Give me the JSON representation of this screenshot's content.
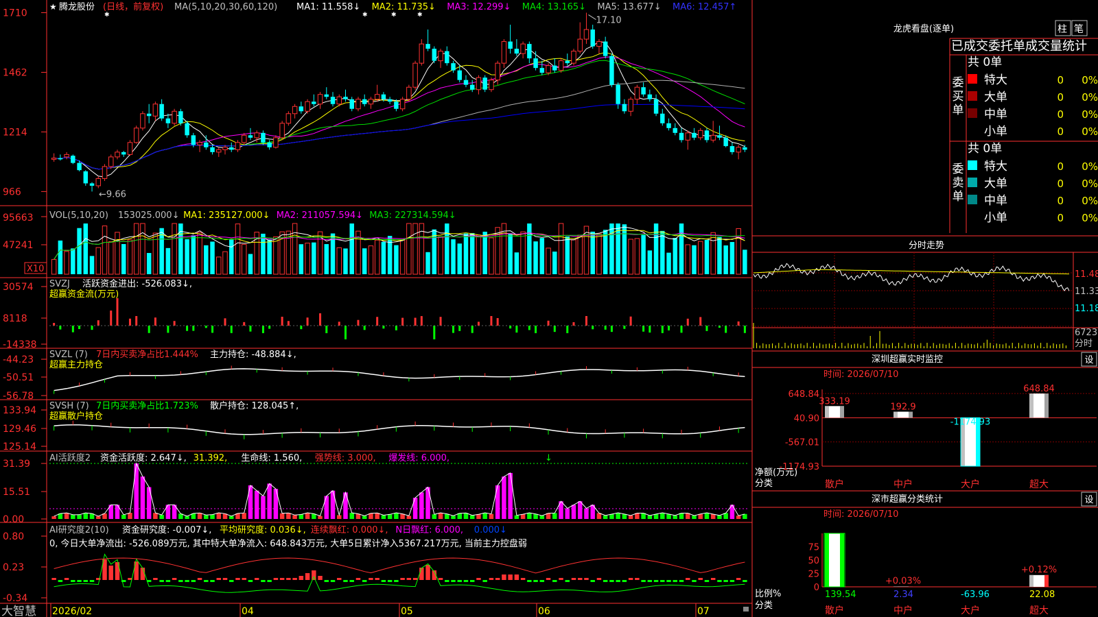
{
  "stock": {
    "name": "腾龙股份",
    "mode": "(日线，前复权)"
  },
  "colors": {
    "up": "#ff3232",
    "down": "#00ffff",
    "ma1": "#ffffff",
    "ma2": "#ffff00",
    "ma3": "#ff00ff",
    "ma4": "#00e000",
    "ma5": "#b0b0b0",
    "ma6": "#0000ff",
    "axis": "#ff3030",
    "grid": "#800000",
    "magenta": "#ff00ff",
    "green": "#00ff00",
    "label": "#ff4040",
    "sideText": "#c0c0c0"
  },
  "kline": {
    "ma_header": "MA(5,10,20,30,60,120)",
    "ma_values": [
      {
        "label": "MA1: 11.558↓",
        "color": "#ffffff"
      },
      {
        "label": "MA2: 11.735↓",
        "color": "#ffff00"
      },
      {
        "label": "MA3: 12.299↓",
        "color": "#ff00ff"
      },
      {
        "label": "MA4: 13.165↓",
        "color": "#00e000"
      },
      {
        "label": "MA5: 13.677↓",
        "color": "#c0c0c0"
      },
      {
        "label": "MA6: 12.457↑",
        "color": "#3333ff"
      }
    ],
    "y_ticks": [
      "1710",
      "1462",
      "1214",
      "966"
    ],
    "high_label": "17.10",
    "low_label": "9.66",
    "candles": [
      {
        "o": 11.0,
        "h": 11.25,
        "l": 10.9,
        "c": 11.05
      },
      {
        "o": 11.05,
        "h": 11.2,
        "l": 10.95,
        "c": 11.0
      },
      {
        "o": 11.1,
        "h": 11.3,
        "l": 11.0,
        "c": 11.2
      },
      {
        "o": 11.15,
        "h": 11.2,
        "l": 10.8,
        "c": 10.85
      },
      {
        "o": 10.85,
        "h": 10.95,
        "l": 10.5,
        "c": 10.55
      },
      {
        "o": 10.5,
        "h": 10.55,
        "l": 9.9,
        "c": 10.0
      },
      {
        "o": 10.0,
        "h": 10.05,
        "l": 9.66,
        "c": 9.9
      },
      {
        "o": 9.9,
        "h": 10.3,
        "l": 9.8,
        "c": 10.2
      },
      {
        "o": 10.2,
        "h": 10.8,
        "l": 10.1,
        "c": 10.7
      },
      {
        "o": 10.7,
        "h": 11.2,
        "l": 10.6,
        "c": 11.1
      },
      {
        "o": 11.1,
        "h": 11.4,
        "l": 11.0,
        "c": 11.3
      },
      {
        "o": 11.3,
        "h": 11.35,
        "l": 11.1,
        "c": 11.2
      },
      {
        "o": 11.2,
        "h": 11.8,
        "l": 11.15,
        "c": 11.7
      },
      {
        "o": 11.7,
        "h": 12.4,
        "l": 11.65,
        "c": 12.3
      },
      {
        "o": 12.3,
        "h": 13.0,
        "l": 12.2,
        "c": 12.9
      },
      {
        "o": 12.9,
        "h": 13.3,
        "l": 12.5,
        "c": 12.8
      },
      {
        "o": 12.8,
        "h": 13.4,
        "l": 12.6,
        "c": 13.3
      },
      {
        "o": 13.3,
        "h": 13.5,
        "l": 12.6,
        "c": 12.7
      },
      {
        "o": 12.7,
        "h": 12.9,
        "l": 12.3,
        "c": 12.5
      },
      {
        "o": 12.5,
        "h": 13.1,
        "l": 12.4,
        "c": 13.0
      },
      {
        "o": 13.0,
        "h": 13.1,
        "l": 12.4,
        "c": 12.5
      },
      {
        "o": 12.5,
        "h": 12.6,
        "l": 11.9,
        "c": 12.0
      },
      {
        "o": 12.0,
        "h": 12.1,
        "l": 11.5,
        "c": 11.6
      },
      {
        "o": 11.6,
        "h": 11.8,
        "l": 11.3,
        "c": 11.7
      },
      {
        "o": 11.7,
        "h": 12.0,
        "l": 11.4,
        "c": 11.5
      },
      {
        "o": 11.5,
        "h": 11.6,
        "l": 11.2,
        "c": 11.3
      },
      {
        "o": 11.3,
        "h": 11.5,
        "l": 11.1,
        "c": 11.4
      },
      {
        "o": 11.4,
        "h": 11.6,
        "l": 11.2,
        "c": 11.5
      },
      {
        "o": 11.5,
        "h": 11.7,
        "l": 11.3,
        "c": 11.4
      },
      {
        "o": 11.4,
        "h": 11.8,
        "l": 11.3,
        "c": 11.7
      },
      {
        "o": 11.7,
        "h": 12.1,
        "l": 11.6,
        "c": 12.0
      },
      {
        "o": 12.0,
        "h": 12.3,
        "l": 11.8,
        "c": 11.9
      },
      {
        "o": 11.9,
        "h": 12.2,
        "l": 11.7,
        "c": 12.1
      },
      {
        "o": 12.1,
        "h": 12.2,
        "l": 11.6,
        "c": 11.7
      },
      {
        "o": 11.7,
        "h": 11.8,
        "l": 11.4,
        "c": 11.5
      },
      {
        "o": 11.5,
        "h": 12.0,
        "l": 11.45,
        "c": 11.9
      },
      {
        "o": 11.9,
        "h": 12.6,
        "l": 11.8,
        "c": 12.5
      },
      {
        "o": 12.5,
        "h": 13.0,
        "l": 12.4,
        "c": 12.9
      },
      {
        "o": 12.9,
        "h": 13.3,
        "l": 12.7,
        "c": 13.2
      },
      {
        "o": 13.2,
        "h": 13.4,
        "l": 12.9,
        "c": 13.0
      },
      {
        "o": 13.0,
        "h": 13.5,
        "l": 12.9,
        "c": 13.4
      },
      {
        "o": 13.4,
        "h": 13.7,
        "l": 13.2,
        "c": 13.3
      },
      {
        "o": 13.3,
        "h": 13.8,
        "l": 13.1,
        "c": 13.7
      },
      {
        "o": 13.7,
        "h": 14.0,
        "l": 13.5,
        "c": 13.6
      },
      {
        "o": 13.6,
        "h": 13.8,
        "l": 13.2,
        "c": 13.3
      },
      {
        "o": 13.3,
        "h": 13.7,
        "l": 13.2,
        "c": 13.6
      },
      {
        "o": 13.6,
        "h": 13.9,
        "l": 13.4,
        "c": 13.5
      },
      {
        "o": 13.5,
        "h": 13.6,
        "l": 13.0,
        "c": 13.1
      },
      {
        "o": 13.1,
        "h": 13.6,
        "l": 13.0,
        "c": 13.5
      },
      {
        "o": 13.5,
        "h": 13.7,
        "l": 13.2,
        "c": 13.3
      },
      {
        "o": 13.3,
        "h": 13.6,
        "l": 13.1,
        "c": 13.5
      },
      {
        "o": 13.5,
        "h": 14.1,
        "l": 13.4,
        "c": 13.7
      },
      {
        "o": 13.7,
        "h": 13.8,
        "l": 13.4,
        "c": 13.5
      },
      {
        "o": 13.5,
        "h": 13.6,
        "l": 13.3,
        "c": 13.4
      },
      {
        "o": 13.4,
        "h": 13.5,
        "l": 13.0,
        "c": 13.1
      },
      {
        "o": 13.1,
        "h": 13.6,
        "l": 13.0,
        "c": 13.5
      },
      {
        "o": 13.5,
        "h": 14.1,
        "l": 13.4,
        "c": 14.0
      },
      {
        "o": 14.0,
        "h": 15.1,
        "l": 13.9,
        "c": 15.0
      },
      {
        "o": 15.0,
        "h": 16.0,
        "l": 14.9,
        "c": 15.8
      },
      {
        "o": 15.8,
        "h": 16.4,
        "l": 15.5,
        "c": 15.6
      },
      {
        "o": 15.6,
        "h": 15.7,
        "l": 15.0,
        "c": 15.1
      },
      {
        "o": 15.1,
        "h": 15.6,
        "l": 14.8,
        "c": 15.5
      },
      {
        "o": 15.5,
        "h": 15.7,
        "l": 14.9,
        "c": 15.0
      },
      {
        "o": 15.0,
        "h": 15.1,
        "l": 14.6,
        "c": 14.7
      },
      {
        "o": 14.7,
        "h": 14.9,
        "l": 14.2,
        "c": 14.3
      },
      {
        "o": 14.3,
        "h": 14.5,
        "l": 14.0,
        "c": 14.1
      },
      {
        "o": 14.1,
        "h": 14.3,
        "l": 13.8,
        "c": 13.9
      },
      {
        "o": 13.9,
        "h": 14.5,
        "l": 13.7,
        "c": 14.4
      },
      {
        "o": 14.4,
        "h": 14.5,
        "l": 13.8,
        "c": 13.9
      },
      {
        "o": 13.9,
        "h": 14.4,
        "l": 13.8,
        "c": 14.3
      },
      {
        "o": 14.3,
        "h": 15.1,
        "l": 14.1,
        "c": 15.0
      },
      {
        "o": 15.0,
        "h": 16.0,
        "l": 14.8,
        "c": 15.9
      },
      {
        "o": 15.9,
        "h": 16.6,
        "l": 15.4,
        "c": 15.6
      },
      {
        "o": 15.6,
        "h": 16.0,
        "l": 15.3,
        "c": 15.4
      },
      {
        "o": 15.4,
        "h": 15.9,
        "l": 15.2,
        "c": 15.8
      },
      {
        "o": 15.8,
        "h": 15.9,
        "l": 15.0,
        "c": 15.2
      },
      {
        "o": 15.2,
        "h": 15.5,
        "l": 14.7,
        "c": 14.8
      },
      {
        "o": 14.8,
        "h": 15.1,
        "l": 14.5,
        "c": 14.6
      },
      {
        "o": 14.6,
        "h": 15.0,
        "l": 14.5,
        "c": 14.9
      },
      {
        "o": 14.9,
        "h": 15.2,
        "l": 14.6,
        "c": 14.7
      },
      {
        "o": 14.7,
        "h": 15.2,
        "l": 14.6,
        "c": 15.1
      },
      {
        "o": 15.1,
        "h": 15.4,
        "l": 14.9,
        "c": 15.0
      },
      {
        "o": 15.0,
        "h": 15.6,
        "l": 14.9,
        "c": 15.5
      },
      {
        "o": 15.5,
        "h": 16.7,
        "l": 15.4,
        "c": 16.0
      },
      {
        "o": 16.0,
        "h": 17.1,
        "l": 15.8,
        "c": 16.4
      },
      {
        "o": 16.4,
        "h": 16.6,
        "l": 15.6,
        "c": 15.7
      },
      {
        "o": 15.7,
        "h": 16.0,
        "l": 15.4,
        "c": 15.9
      },
      {
        "o": 15.9,
        "h": 16.1,
        "l": 15.2,
        "c": 15.3
      },
      {
        "o": 15.3,
        "h": 15.4,
        "l": 14.0,
        "c": 14.1
      },
      {
        "o": 14.1,
        "h": 14.2,
        "l": 13.1,
        "c": 13.3
      },
      {
        "o": 13.3,
        "h": 13.5,
        "l": 12.9,
        "c": 13.0
      },
      {
        "o": 13.0,
        "h": 13.6,
        "l": 12.8,
        "c": 13.5
      },
      {
        "o": 13.5,
        "h": 14.1,
        "l": 13.3,
        "c": 14.0
      },
      {
        "o": 14.0,
        "h": 14.2,
        "l": 13.6,
        "c": 13.7
      },
      {
        "o": 13.7,
        "h": 13.9,
        "l": 13.4,
        "c": 13.5
      },
      {
        "o": 13.5,
        "h": 13.7,
        "l": 12.8,
        "c": 12.9
      },
      {
        "o": 12.9,
        "h": 13.1,
        "l": 12.4,
        "c": 12.5
      },
      {
        "o": 12.5,
        "h": 12.7,
        "l": 12.2,
        "c": 12.3
      },
      {
        "o": 12.3,
        "h": 12.5,
        "l": 12.0,
        "c": 12.1
      },
      {
        "o": 12.1,
        "h": 12.3,
        "l": 11.7,
        "c": 11.8
      },
      {
        "o": 11.8,
        "h": 12.2,
        "l": 11.4,
        "c": 12.1
      },
      {
        "o": 12.1,
        "h": 12.3,
        "l": 11.8,
        "c": 11.9
      },
      {
        "o": 11.9,
        "h": 12.3,
        "l": 11.8,
        "c": 12.2
      },
      {
        "o": 12.2,
        "h": 12.3,
        "l": 11.7,
        "c": 11.8
      },
      {
        "o": 11.8,
        "h": 12.6,
        "l": 11.7,
        "c": 12.0
      },
      {
        "o": 12.0,
        "h": 12.4,
        "l": 11.8,
        "c": 11.9
      },
      {
        "o": 11.9,
        "h": 12.0,
        "l": 11.5,
        "c": 11.55
      },
      {
        "o": 11.55,
        "h": 11.7,
        "l": 11.2,
        "c": 11.3
      },
      {
        "o": 11.3,
        "h": 11.6,
        "l": 11.0,
        "c": 11.5
      },
      {
        "o": 11.5,
        "h": 11.6,
        "l": 11.3,
        "c": 11.4
      }
    ]
  },
  "vol": {
    "header": "VOL(5,10,20)",
    "values": [
      {
        "t": "153025.000↓",
        "c": "#c0c0c0"
      },
      {
        "t": "MA1: 235127.000↓",
        "c": "#ffff00"
      },
      {
        "t": "MA2: 211057.594↓",
        "c": "#ff00ff"
      },
      {
        "t": "MA3: 227314.594↓",
        "c": "#00e000"
      }
    ],
    "y_ticks": [
      "95663",
      "47241"
    ],
    "unit": "X10"
  },
  "svzj": {
    "header": "SVZJ",
    "title": "活跃资金进出: -526.083↓,",
    "sub": "超赢资金流(万元)",
    "y_ticks": [
      "30574",
      "8118",
      "-14338"
    ]
  },
  "svzl": {
    "header": "SVZL (7)",
    "text1": "7日内买卖净占比1.444%",
    "text2": "主力持仓: -48.884↓,",
    "sub": "超赢主力持仓",
    "y_ticks": [
      "-44.23",
      "-50.51",
      "-56.78"
    ]
  },
  "svsh": {
    "header": "SVSH (7)",
    "text1": "7日内买卖净占比1.723%",
    "text2": "散户持仓: 128.045↑,",
    "sub": "超赢散户持仓",
    "y_ticks": [
      "133.94",
      "129.46",
      "125.14"
    ]
  },
  "ai_active": {
    "header": "AI活跃度2",
    "values": [
      {
        "t": "资金活跃度: 2.647↓,",
        "c": "#ffffff"
      },
      {
        "t": "31.392,",
        "c": "#ffff00"
      },
      {
        "t": "生命线: 1.560,",
        "c": "#ffffff"
      },
      {
        "t": "强势线: 3.000,",
        "c": "#ff3030"
      },
      {
        "t": "爆发线: 6.000,",
        "c": "#ff00ff"
      }
    ],
    "y_ticks": [
      "31.39",
      "15.51",
      "0.00"
    ]
  },
  "ai_research": {
    "header": "AI研究度2(10)",
    "values": [
      {
        "t": "资金研究度: -0.007↓,",
        "c": "#ffffff"
      },
      {
        "t": "平均研究度: 0.036↓,",
        "c": "#ffff00"
      },
      {
        "t": "连续飘红: 0.000↓,",
        "c": "#ff3030"
      },
      {
        "t": "N日飘红: 6.000,",
        "c": "#ff00ff"
      },
      {
        "t": "0.000↓",
        "c": "#0044ff"
      }
    ],
    "summary": "0, 今日大单净流出: -526.089万元, 其中特大单净流入: 648.843万元, 大单5日累计净入5367.217万元, 当前主力控盘弱",
    "y_ticks": [
      "0.80",
      "0.23",
      "-0.34"
    ]
  },
  "x_labels": [
    "2026/02",
    "04",
    "05",
    "06",
    "07"
  ],
  "brand": "大智慧",
  "longhu": {
    "title": "龙虎看盘(逐单)",
    "btn1": "柱",
    "btn2": "笔",
    "tabs_title": "已成交委托单成交量统计",
    "buy_label": "委买单",
    "sell_label": "委卖单",
    "buy_total": "共 0单",
    "sell_total": "共 0单",
    "buy_rows": [
      {
        "name": "特大",
        "v": "0",
        "p": "0%",
        "c": "#ff0000"
      },
      {
        "name": "大单",
        "v": "0",
        "p": "0%",
        "c": "#aa0000"
      },
      {
        "name": "中单",
        "v": "0",
        "p": "0%",
        "c": "#770000"
      },
      {
        "name": "小单",
        "v": "0",
        "p": "0%",
        "c": "#000000"
      }
    ],
    "sell_rows": [
      {
        "name": "特大",
        "v": "0",
        "p": "0%",
        "c": "#00ffff"
      },
      {
        "name": "大单",
        "v": "0",
        "p": "0%",
        "c": "#00aaaa"
      },
      {
        "name": "中单",
        "v": "0",
        "p": "0%",
        "c": "#008888"
      },
      {
        "name": "小单",
        "v": "0",
        "p": "0%",
        "c": "#000000"
      }
    ]
  },
  "fenshi": {
    "title": "分时走势",
    "y_ticks": [
      "11.48",
      "11.33",
      "11.18"
    ],
    "vol_tick": "6723",
    "vol_label": "分时"
  },
  "monitor": {
    "title": "深圳超赢实时监控",
    "set": "设",
    "time": "时间: 2026/07/10",
    "y_ticks": [
      "648.84",
      "40.90",
      "-567.01",
      "-1174.93"
    ],
    "y_label": "净额(万元)",
    "x_label": "分类",
    "categories": [
      "散户",
      "中户",
      "大户",
      "超大"
    ],
    "values": [
      333.19,
      192.9,
      -1174.93,
      648.84
    ],
    "value_labels": [
      "333.19",
      "192.9",
      "-1174.93",
      "648.84"
    ]
  },
  "classify": {
    "title": "深市超赢分类统计",
    "set": "设",
    "time": "时间: 2026/07/10",
    "y_ticks": [
      "75",
      "50",
      "25",
      "0"
    ],
    "y_label": "比例%",
    "x_label": "分类",
    "categories": [
      "散户",
      "中户",
      "大户",
      "超大"
    ],
    "top_labels": [
      "",
      "+0.03%",
      "",
      "+0.12%"
    ],
    "values": [
      "139.54",
      "2.34",
      "-63.96",
      "22.08"
    ]
  },
  "chart_data": {
    "type": "bar",
    "title": "深圳超赢实时监控",
    "categories": [
      "散户",
      "中户",
      "大户",
      "超大"
    ],
    "values": [
      333.19,
      192.9,
      -1174.93,
      648.84
    ],
    "ylabel": "净额(万元)",
    "xlabel": "分类",
    "ylim": [
      -1174.93,
      648.84
    ]
  }
}
